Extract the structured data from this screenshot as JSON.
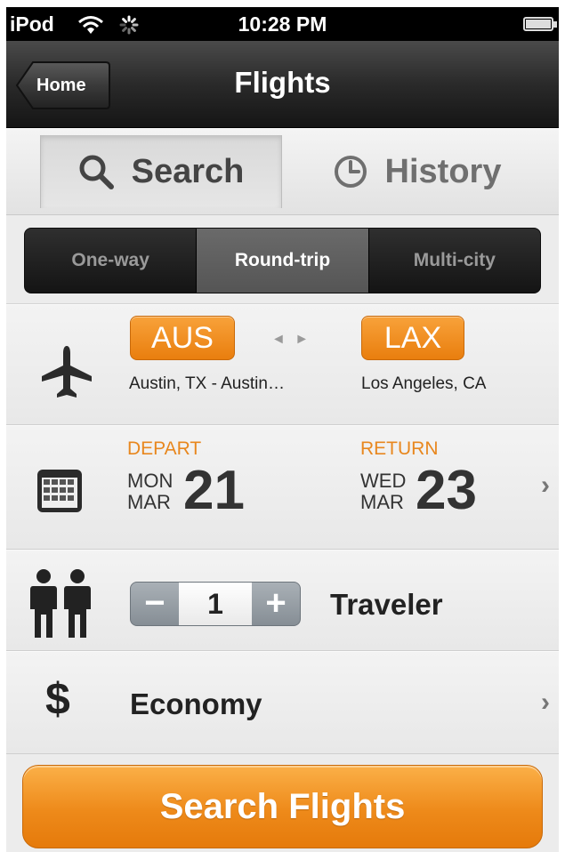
{
  "status_bar": {
    "carrier": "iPod",
    "time": "10:28 PM",
    "icons": [
      "wifi-icon",
      "activity-spinner-icon",
      "battery-icon"
    ]
  },
  "nav": {
    "back_label": "Home",
    "title": "Flights"
  },
  "tabs": [
    {
      "label": "Search",
      "icon": "search-icon",
      "selected": true
    },
    {
      "label": "History",
      "icon": "clock-icon",
      "selected": false
    }
  ],
  "trip_type": {
    "options": [
      "One-way",
      "Round-trip",
      "Multi-city"
    ],
    "selected": "Round-trip"
  },
  "route": {
    "from_code": "AUS",
    "from_city": "Austin, TX - Austin…",
    "to_code": "LAX",
    "to_city": "Los Angeles, CA",
    "swap_glyph": "◄ ►"
  },
  "dates": {
    "depart": {
      "label": "DEPART",
      "weekday": "MON",
      "month": "MAR",
      "day": "21"
    },
    "return": {
      "label": "RETURN",
      "weekday": "WED",
      "month": "MAR",
      "day": "23"
    }
  },
  "travelers": {
    "count": "1",
    "minus": "−",
    "plus": "+",
    "label": "Traveler"
  },
  "cabin": {
    "symbol": "$",
    "label": "Economy"
  },
  "chevron": "›",
  "cta": {
    "label": "Search Flights"
  },
  "colors": {
    "accent_orange": "#ee8a1a",
    "label_orange": "#e8871e",
    "nav_dark": "#1a1a1a",
    "stepper_gray": "#8f979e"
  }
}
